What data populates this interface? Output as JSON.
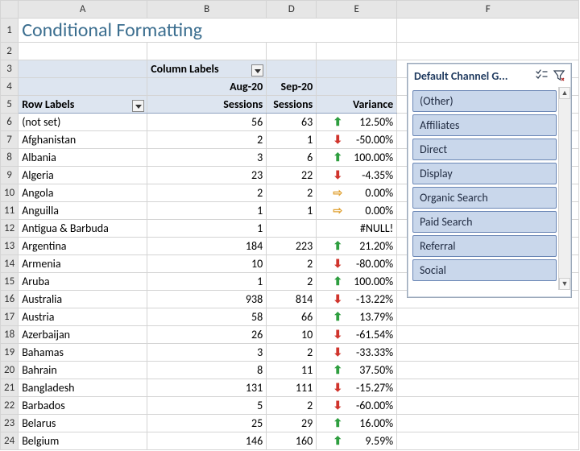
{
  "title": "Conditional Formatting",
  "column_headers": [
    "A",
    "B",
    "D",
    "E",
    "F"
  ],
  "pivot": {
    "column_labels_label": "Column Labels",
    "row_labels_label": "Row Labels",
    "month1": "Aug-20",
    "month2": "Sep-20",
    "col_b_sub": "Sessions",
    "col_d_sub": "Sessions",
    "col_e_sub": "Variance"
  },
  "rows": [
    {
      "n": "6",
      "label": "(not set)",
      "aug": "56",
      "sep": "63",
      "dir": "up",
      "var": "12.50%"
    },
    {
      "n": "7",
      "label": "Afghanistan",
      "aug": "2",
      "sep": "1",
      "dir": "down",
      "var": "-50.00%"
    },
    {
      "n": "8",
      "label": "Albania",
      "aug": "3",
      "sep": "6",
      "dir": "up",
      "var": "100.00%"
    },
    {
      "n": "9",
      "label": "Algeria",
      "aug": "23",
      "sep": "22",
      "dir": "down",
      "var": "-4.35%"
    },
    {
      "n": "10",
      "label": "Angola",
      "aug": "2",
      "sep": "2",
      "dir": "side",
      "var": "0.00%"
    },
    {
      "n": "11",
      "label": "Anguilla",
      "aug": "1",
      "sep": "1",
      "dir": "side",
      "var": "0.00%"
    },
    {
      "n": "12",
      "label": "Antigua & Barbuda",
      "aug": "1",
      "sep": "",
      "dir": "",
      "var": "#NULL!"
    },
    {
      "n": "13",
      "label": "Argentina",
      "aug": "184",
      "sep": "223",
      "dir": "up",
      "var": "21.20%"
    },
    {
      "n": "14",
      "label": "Armenia",
      "aug": "10",
      "sep": "2",
      "dir": "down",
      "var": "-80.00%"
    },
    {
      "n": "15",
      "label": "Aruba",
      "aug": "1",
      "sep": "2",
      "dir": "up",
      "var": "100.00%"
    },
    {
      "n": "16",
      "label": "Australia",
      "aug": "938",
      "sep": "814",
      "dir": "down",
      "var": "-13.22%"
    },
    {
      "n": "17",
      "label": "Austria",
      "aug": "58",
      "sep": "66",
      "dir": "up",
      "var": "13.79%"
    },
    {
      "n": "18",
      "label": "Azerbaijan",
      "aug": "26",
      "sep": "10",
      "dir": "down",
      "var": "-61.54%"
    },
    {
      "n": "19",
      "label": "Bahamas",
      "aug": "3",
      "sep": "2",
      "dir": "down",
      "var": "-33.33%"
    },
    {
      "n": "20",
      "label": "Bahrain",
      "aug": "8",
      "sep": "11",
      "dir": "up",
      "var": "37.50%"
    },
    {
      "n": "21",
      "label": "Bangladesh",
      "aug": "131",
      "sep": "111",
      "dir": "down",
      "var": "-15.27%"
    },
    {
      "n": "22",
      "label": "Barbados",
      "aug": "5",
      "sep": "2",
      "dir": "down",
      "var": "-60.00%"
    },
    {
      "n": "23",
      "label": "Belarus",
      "aug": "25",
      "sep": "29",
      "dir": "up",
      "var": "16.00%"
    },
    {
      "n": "24",
      "label": "Belgium",
      "aug": "146",
      "sep": "160",
      "dir": "up",
      "var": "9.59%"
    }
  ],
  "slicer": {
    "title": "Default Channel G...",
    "items": [
      "(Other)",
      "Affiliates",
      "Direct",
      "Display",
      "Organic Search",
      "Paid Search",
      "Referral",
      "Social"
    ]
  },
  "icons": {
    "up": "⬆",
    "down": "⬇",
    "side": "⇨"
  }
}
